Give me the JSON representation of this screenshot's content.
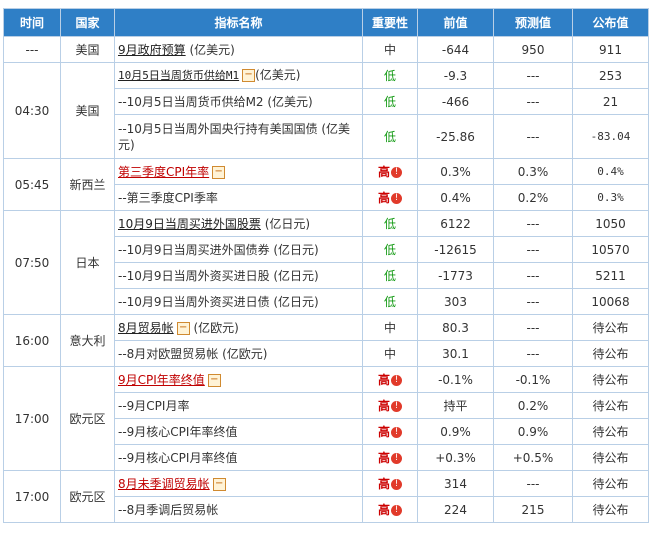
{
  "header": {
    "time": "时间",
    "country": "国家",
    "indicator": "指标名称",
    "importance": "重要性",
    "previous": "前值",
    "forecast": "预测值",
    "published": "公布值"
  },
  "rows": [
    {
      "time": "---",
      "country": "美国",
      "name": "9月政府预算",
      "unit": " (亿美元)",
      "imp": "中",
      "prev": "-644",
      "fcst": "950",
      "pub": "911"
    },
    {
      "time": "04:30",
      "country": "美国",
      "name": "10月5日当周货币供给M1",
      "unit": "(亿美元)",
      "imp": "低",
      "prev": "-9.3",
      "fcst": "---",
      "pub": "253"
    },
    {
      "name": "--10月5日当周货币供给M2 (亿美元)",
      "imp": "低",
      "prev": "-466",
      "fcst": "---",
      "pub": "21"
    },
    {
      "name": "--10月5日当周外国央行持有美国国债 (亿美元)",
      "imp": "低",
      "prev": "-25.86",
      "fcst": "---",
      "pub": "-83.04"
    },
    {
      "time": "05:45",
      "country": "新西兰",
      "name": "第三季度CPI年率",
      "imp": "高",
      "prev": "0.3%",
      "fcst": "0.3%",
      "pub": "0.4%"
    },
    {
      "name": "--第三季度CPI季率",
      "imp": "高",
      "prev": "0.4%",
      "fcst": "0.2%",
      "pub": "0.3%"
    },
    {
      "time": "07:50",
      "country": "日本",
      "name": "10月9日当周买进外国股票",
      "unit": " (亿日元)",
      "imp": "低",
      "prev": "6122",
      "fcst": "---",
      "pub": "1050"
    },
    {
      "name": "--10月9日当周买进外国债券 (亿日元)",
      "imp": "低",
      "prev": "-12615",
      "fcst": "---",
      "pub": "10570"
    },
    {
      "name": "--10月9日当周外资买进日股 (亿日元)",
      "imp": "低",
      "prev": "-1773",
      "fcst": "---",
      "pub": "5211"
    },
    {
      "name": "--10月9日当周外资买进日债 (亿日元)",
      "imp": "低",
      "prev": "303",
      "fcst": "---",
      "pub": "10068"
    },
    {
      "time": "16:00",
      "country": "意大利",
      "name": "8月贸易帐",
      "unit": " (亿欧元)",
      "imp": "中",
      "prev": "80.3",
      "fcst": "---",
      "pub": "待公布"
    },
    {
      "name": "--8月对欧盟贸易帐 (亿欧元)",
      "imp": "中",
      "prev": "30.1",
      "fcst": "---",
      "pub": "待公布"
    },
    {
      "time": "17:00",
      "country": "欧元区",
      "name": "9月CPI年率终值",
      "imp": "高",
      "prev": "-0.1%",
      "fcst": "-0.1%",
      "pub": "待公布"
    },
    {
      "name": "--9月CPI月率",
      "imp": "高",
      "prev": "持平",
      "fcst": "0.2%",
      "pub": "待公布"
    },
    {
      "name": "--9月核心CPI年率终值",
      "imp": "高",
      "prev": "0.9%",
      "fcst": "0.9%",
      "pub": "待公布"
    },
    {
      "name": "--9月核心CPI月率终值",
      "imp": "高",
      "prev": "+0.3%",
      "fcst": "+0.5%",
      "pub": "待公布"
    },
    {
      "time": "17:00",
      "country": "欧元区",
      "name": "8月未季调贸易帐",
      "imp": "高",
      "prev": "314",
      "fcst": "---",
      "pub": "待公布"
    },
    {
      "name": "--8月季调后贸易帐",
      "imp": "高",
      "prev": "224",
      "fcst": "215",
      "pub": "待公布"
    }
  ],
  "icons": {
    "expand": "−",
    "alert": "!"
  }
}
